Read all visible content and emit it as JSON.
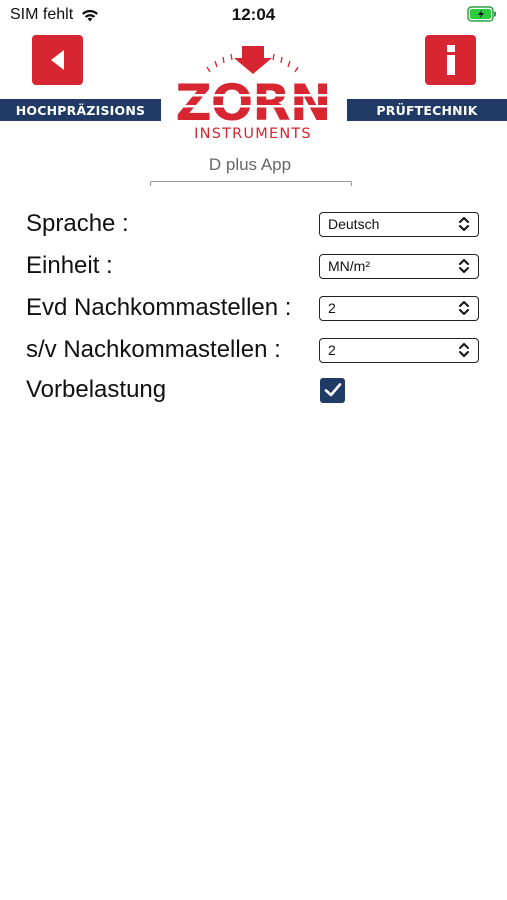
{
  "status_bar": {
    "carrier": "SIM fehlt",
    "time": "12:04"
  },
  "header": {
    "band_left": "HOCHPRÄZISIONS",
    "band_right": "PRÜFTECHNIK",
    "logo_text": "ZORN",
    "logo_subtext": "INSTRUMENTS",
    "brand_color": "#d72631",
    "band_color": "#1f3a64"
  },
  "app_title": "D plus App",
  "settings": {
    "language": {
      "label": "Sprache :",
      "value": "Deutsch"
    },
    "unit": {
      "label": "Einheit :",
      "value": "MN/m²"
    },
    "evd_decimals": {
      "label": "Evd Nachkommastellen :",
      "value": "2"
    },
    "sv_decimals": {
      "label": "s/v Nachkommastellen :",
      "value": "2"
    },
    "preload": {
      "label": "Vorbelastung",
      "checked": true
    }
  },
  "icons": {
    "back": "back-arrow-icon",
    "info": "info-icon",
    "wifi": "wifi-icon",
    "battery": "battery-charging-icon",
    "select": "chevron-up-down-icon",
    "check": "checkmark-icon"
  }
}
